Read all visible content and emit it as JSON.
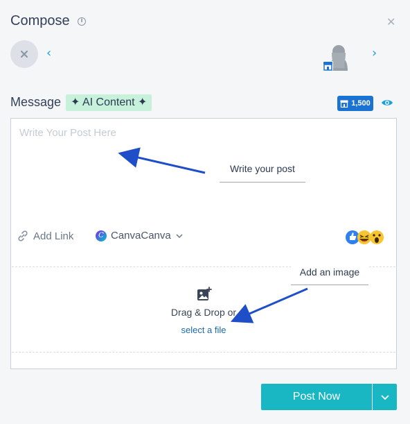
{
  "header": {
    "title": "Compose",
    "info_icon": "info-icon",
    "close_icon": "close-icon"
  },
  "profiles": {
    "remove_icon": "close-icon",
    "prev_icon": "chevron-left-icon",
    "next_icon": "chevron-right-icon",
    "avatar_icon": "avatar-silhouette",
    "badge_icon": "store-icon"
  },
  "message": {
    "label": "Message",
    "ai_button": "✦ AI Content ✦",
    "char_count": "1,500",
    "preview_icon": "eye-icon"
  },
  "editor": {
    "placeholder": "Write Your Post Here",
    "value": "",
    "add_link_label": "Add Link",
    "canva_label": "CanvaCanva",
    "emoji_icon": "emoji-reactions-icon"
  },
  "dropzone": {
    "text": "Drag & Drop or",
    "link": "select a file",
    "icon": "add-image-icon"
  },
  "annotations": {
    "write_post": "Write your post",
    "add_image": "Add an image"
  },
  "actions": {
    "post_now": "Post Now",
    "dropdown_icon": "chevron-down-icon"
  },
  "colors": {
    "accent": "#19b7c4",
    "link_blue": "#1aa3d9",
    "ai_chip_bg": "#c8f1dc",
    "char_chip_bg": "#1a73d2",
    "arrow": "#1f4ec9"
  }
}
